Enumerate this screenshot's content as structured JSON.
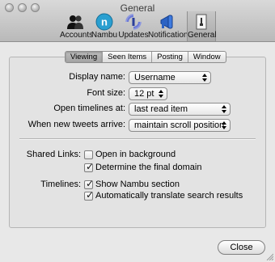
{
  "window": {
    "title": "General"
  },
  "toolbar": {
    "items": [
      {
        "label": "Accounts",
        "icon": "accounts-icon"
      },
      {
        "label": "Nambu",
        "icon": "nambu-icon"
      },
      {
        "label": "Updates",
        "icon": "updates-icon"
      },
      {
        "label": "Notifications",
        "icon": "notifications-icon"
      },
      {
        "label": "General",
        "icon": "general-icon",
        "selected": true
      }
    ]
  },
  "tabs": [
    {
      "label": "Viewing",
      "active": true
    },
    {
      "label": "Seen Items"
    },
    {
      "label": "Posting"
    },
    {
      "label": "Window"
    }
  ],
  "settings": {
    "display_name": {
      "label": "Display name:",
      "value": "Username"
    },
    "font_size": {
      "label": "Font size:",
      "value": "12 pt"
    },
    "open_timelines": {
      "label": "Open timelines at:",
      "value": "last read item"
    },
    "new_tweets": {
      "label": "When new tweets arrive:",
      "value": "maintain scroll position"
    }
  },
  "shared_links": {
    "label": "Shared Links:",
    "options": [
      {
        "label": "Open in background",
        "checked": false
      },
      {
        "label": "Determine the final domain",
        "checked": true
      }
    ]
  },
  "timelines": {
    "label": "Timelines:",
    "options": [
      {
        "label": "Show Nambu section",
        "checked": true
      },
      {
        "label": "Automatically translate search results",
        "checked": true
      }
    ]
  },
  "buttons": {
    "close": "Close"
  },
  "colors": {
    "nambu_accent": "#2a9fd0",
    "notifications_accent": "#2b63c4"
  }
}
